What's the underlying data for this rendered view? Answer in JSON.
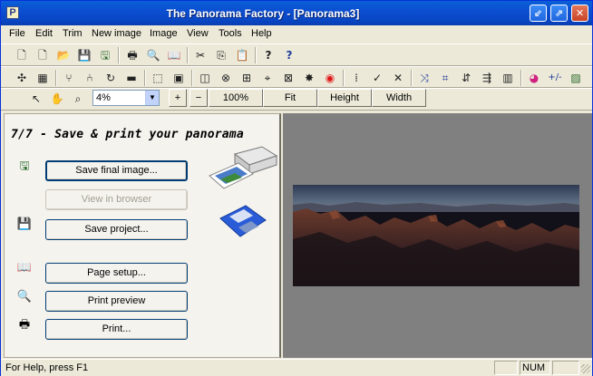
{
  "window": {
    "title": "The Panorama Factory - [Panorama3]"
  },
  "titlebar_buttons": {
    "minimize": "⇙",
    "restore": "⇗",
    "close": "✕"
  },
  "menu": [
    "File",
    "Edit",
    "Trim",
    "New image",
    "Image",
    "View",
    "Tools",
    "Help"
  ],
  "zoom": {
    "value": "4%",
    "plus": "+",
    "minus": "−",
    "actual": "100%",
    "fit": "Fit",
    "height": "Height",
    "width": "Width"
  },
  "wizard": {
    "step_title": "7/7 - Save & print your panorama",
    "buttons": {
      "save_final": "Save final image...",
      "view_browser": "View in browser",
      "save_project": "Save project...",
      "page_setup": "Page setup...",
      "print_preview": "Print preview",
      "print": "Print..."
    }
  },
  "status": {
    "help": "For Help, press F1",
    "num": "NUM"
  },
  "icons": {
    "row1": [
      {
        "name": "new-file-icon",
        "glyph": "🗋"
      },
      {
        "name": "new-wizard-icon",
        "glyph": "🗋"
      },
      {
        "name": "open-icon",
        "glyph": "📂"
      },
      {
        "name": "save-icon",
        "glyph": "💾"
      },
      {
        "name": "save-final-icon",
        "glyph": "🖫"
      },
      {
        "name": "print-icon",
        "glyph": "🖶"
      },
      {
        "name": "print-preview-icon",
        "glyph": "🔍"
      },
      {
        "name": "page-setup-icon",
        "glyph": "📖"
      },
      {
        "name": "cut-icon",
        "glyph": "✂"
      },
      {
        "name": "copy-icon",
        "glyph": "⎘"
      },
      {
        "name": "paste-icon",
        "glyph": "📋"
      },
      {
        "name": "help-icon",
        "glyph": "?"
      },
      {
        "name": "context-help-icon",
        "glyph": "?"
      }
    ],
    "row2": [
      {
        "name": "crop-icon",
        "glyph": "✣"
      },
      {
        "name": "grid-icon",
        "glyph": "▦"
      },
      {
        "name": "split-icon",
        "glyph": "⑂"
      },
      {
        "name": "join-icon",
        "glyph": "⑃"
      },
      {
        "name": "rotate-icon",
        "glyph": "↻"
      },
      {
        "name": "film-icon",
        "glyph": "▬"
      },
      {
        "name": "select-image-icon",
        "glyph": "⬚"
      },
      {
        "name": "image-settings-icon",
        "glyph": "▣"
      },
      {
        "name": "lens-icon",
        "glyph": "◫"
      },
      {
        "name": "wheel-icon",
        "glyph": "⊗"
      },
      {
        "name": "stitch-icon",
        "glyph": "⊞"
      },
      {
        "name": "align-icon",
        "glyph": "⌖"
      },
      {
        "name": "blend-icon",
        "glyph": "⊠"
      },
      {
        "name": "burst-icon",
        "glyph": "✸"
      },
      {
        "name": "record-icon",
        "glyph": "◉"
      },
      {
        "name": "points-grid-icon",
        "glyph": "⁞"
      },
      {
        "name": "accept-icon",
        "glyph": "✓"
      },
      {
        "name": "reject-icon",
        "glyph": "✕"
      },
      {
        "name": "warp-icon",
        "glyph": "⤨"
      },
      {
        "name": "trim-icon",
        "glyph": "⌗"
      },
      {
        "name": "level-icon",
        "glyph": "⇵"
      },
      {
        "name": "sharpen-icon",
        "glyph": "⇶"
      },
      {
        "name": "histogram-icon",
        "glyph": "▥"
      },
      {
        "name": "color-wheel-icon",
        "glyph": "◕"
      },
      {
        "name": "plus-minus-icon",
        "glyph": "+/-"
      },
      {
        "name": "landscape-icon",
        "glyph": "▨"
      }
    ],
    "row3": [
      {
        "name": "pointer-icon",
        "glyph": "↖"
      },
      {
        "name": "hand-icon",
        "glyph": "✋"
      },
      {
        "name": "zoom-icon",
        "glyph": "⌕"
      }
    ],
    "wizard": {
      "save_final": "🖫",
      "save_project": "💾",
      "page_setup": "📖",
      "print_preview": "🔍",
      "print": "🖶"
    }
  }
}
